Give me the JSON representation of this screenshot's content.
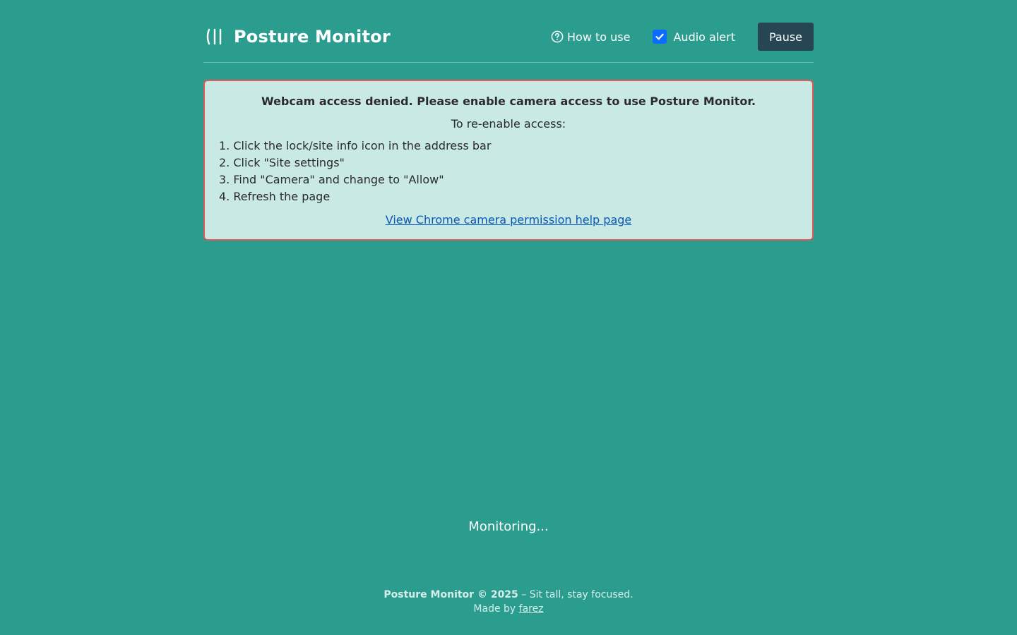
{
  "header": {
    "title": "Posture Monitor",
    "how_to_label": "How to use",
    "audio_alert_label": "Audio alert",
    "audio_alert_checked": true,
    "pause_label": "Pause"
  },
  "alert": {
    "title": "Webcam access denied. Please enable camera access to use Posture Monitor.",
    "subtitle": "To re-enable access:",
    "steps": [
      "1. Click the lock/site info icon in the address bar",
      "2. Click \"Site settings\"",
      "3. Find \"Camera\" and change to \"Allow\"",
      "4. Refresh the page"
    ],
    "link_text": "View Chrome camera permission help page"
  },
  "status_text": "Monitoring...",
  "footer": {
    "brand": "Posture Monitor © 2025",
    "tagline": " – Sit tall, stay focused.",
    "made_by": "Made by ",
    "author": "farez"
  },
  "colors": {
    "background": "#2a9d8f",
    "pause_button": "#264653",
    "alert_border": "#e05a5a",
    "alert_background": "#c9e9e4",
    "checkbox": "#0b6cff"
  },
  "icons": {
    "brand": "posture-lines-icon",
    "help": "question-circle-icon",
    "check": "checkmark-icon"
  }
}
